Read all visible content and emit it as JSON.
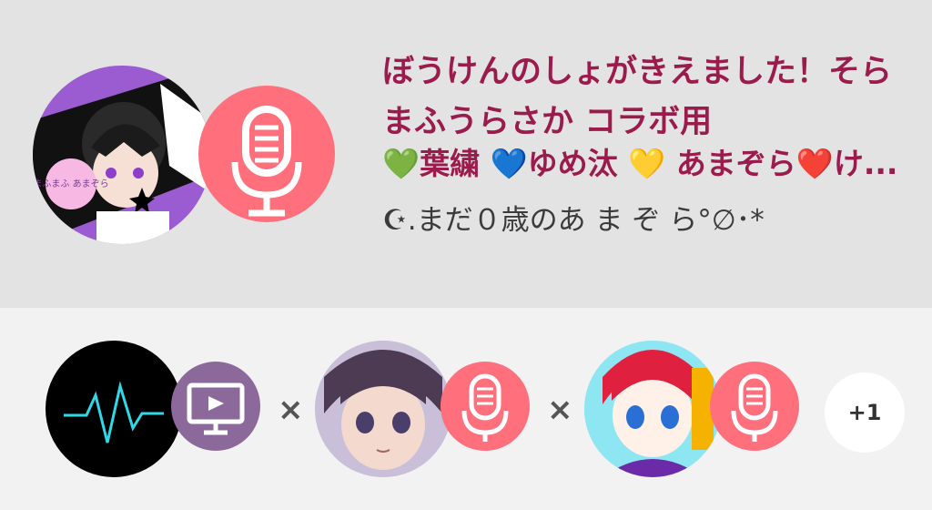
{
  "collab": {
    "title": "ぼうけんのしょがきえました！そらまふうらさか コラボ用",
    "members_line": "💚葉繍 💙ゆめ汰 💛 あまぞら❤️け...",
    "subtitle": "☪.まだ０歳のあ ま ぞ ら°∅･*",
    "main_avatar_label": "まふまふ あまぞら",
    "main_badge_icon": "microphone-icon"
  },
  "participants": [
    {
      "name_icon": "waveform-icon",
      "badge_icon": "video-monitor-icon",
      "badge_color": "#8b6a9b"
    },
    {
      "name_icon": "anime-avatar",
      "badge_icon": "microphone-icon",
      "badge_color": "#ff6f7c"
    },
    {
      "name_icon": "anime-avatar-red-hair",
      "badge_icon": "microphone-icon",
      "badge_color": "#ff6f7c"
    }
  ],
  "separator": "×",
  "more_count": "+1",
  "colors": {
    "accent": "#9b1b4c",
    "mic_badge": "#ff6f7c",
    "video_badge": "#8b6a9b"
  }
}
